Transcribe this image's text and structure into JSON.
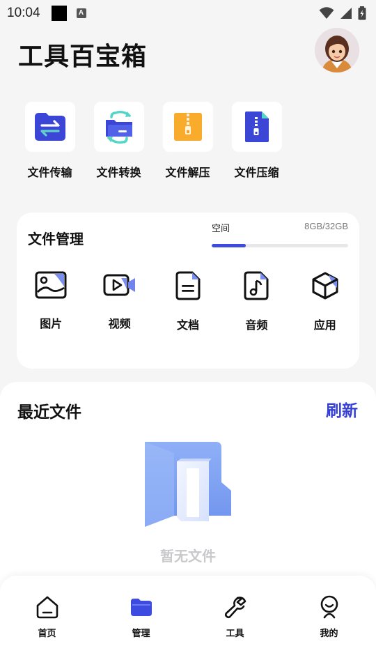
{
  "status": {
    "time": "10:04",
    "notif_letter": "A"
  },
  "header": {
    "title": "工具百宝箱"
  },
  "tools": [
    {
      "label": "文件传输",
      "icon": "file-transfer-icon"
    },
    {
      "label": "文件转换",
      "icon": "file-convert-icon"
    },
    {
      "label": "文件解压",
      "icon": "file-unzip-icon"
    },
    {
      "label": "文件压缩",
      "icon": "file-compress-icon"
    }
  ],
  "file_manager": {
    "title": "文件管理",
    "space_label": "空间",
    "space_value": "8GB/32GB",
    "space_used_fraction": 0.25,
    "categories": [
      {
        "label": "图片",
        "icon": "image-icon"
      },
      {
        "label": "视频",
        "icon": "video-icon"
      },
      {
        "label": "文档",
        "icon": "document-icon"
      },
      {
        "label": "音频",
        "icon": "audio-icon"
      },
      {
        "label": "应用",
        "icon": "app-cube-icon"
      }
    ]
  },
  "recent": {
    "title": "最近文件",
    "refresh_label": "刷新",
    "empty_text": "暂无文件"
  },
  "bottom_nav": [
    {
      "label": "首页",
      "icon": "home-icon",
      "active": false
    },
    {
      "label": "管理",
      "icon": "folder-icon",
      "active": true
    },
    {
      "label": "工具",
      "icon": "wrench-icon",
      "active": false
    },
    {
      "label": "我的",
      "icon": "profile-icon",
      "active": false
    }
  ],
  "colors": {
    "accent": "#3d4be0",
    "refresh": "#3540d8",
    "background": "#f5f5f6"
  }
}
